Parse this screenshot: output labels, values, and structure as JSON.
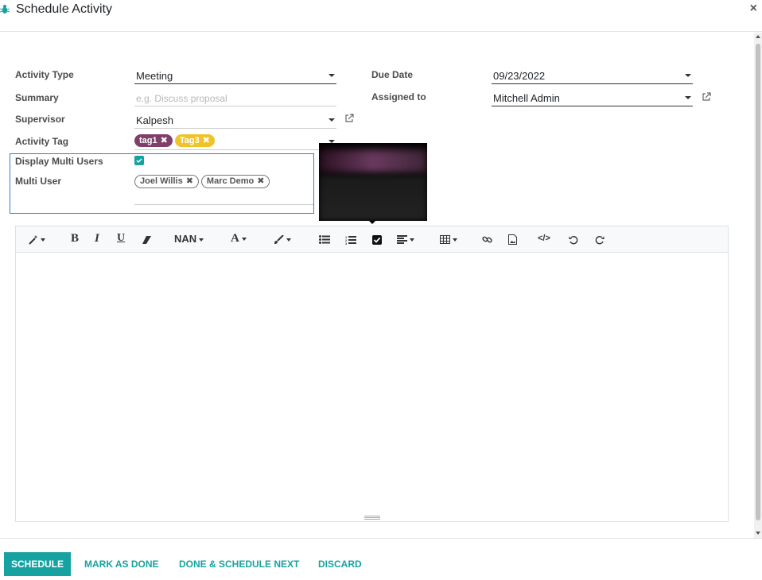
{
  "header": {
    "title": "Schedule Activity",
    "close_icon": "close-icon"
  },
  "form": {
    "activity_type": {
      "label": "Activity Type",
      "value": "Meeting"
    },
    "summary": {
      "label": "Summary",
      "placeholder": "e.g. Discuss proposal"
    },
    "supervisor": {
      "label": "Supervisor",
      "value": "Kalpesh"
    },
    "activity_tag": {
      "label": "Activity Tag",
      "tags": [
        "tag1",
        "Tag3"
      ]
    },
    "display_multi_users": {
      "label": "Display Multi Users",
      "checked": true
    },
    "multi_user": {
      "label": "Multi User",
      "users": [
        "Joel Willis",
        "Marc Demo"
      ]
    },
    "due_date": {
      "label": "Due Date",
      "value": "09/23/2022"
    },
    "assigned_to": {
      "label": "Assigned to",
      "value": "Mitchell Admin"
    }
  },
  "toolbar": {
    "font_size": "NAN",
    "bold": "B",
    "italic": "I",
    "underline": "U",
    "font_color": "A"
  },
  "footer": {
    "schedule": "SCHEDULE",
    "mark_as_done": "MARK AS DONE",
    "done_schedule_next": "DONE & SCHEDULE NEXT",
    "discard": "DISCARD"
  },
  "colors": {
    "accent": "#17a2a2",
    "tag1": "#7f3f6a",
    "tag3": "#f0c32a",
    "focus_border": "#3a7bd5"
  }
}
